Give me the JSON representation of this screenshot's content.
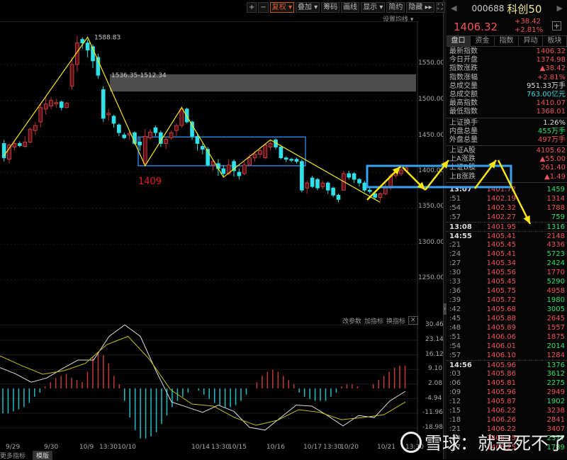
{
  "toolbar": {
    "zoom_in": "+",
    "zoom_out": "−",
    "items": [
      "复权 ▾",
      "叠加 ▾",
      "筹码",
      "画线",
      "显示 ▾",
      "简约",
      "隐藏 ▸▸"
    ],
    "fullscreen": "⛶"
  },
  "ma_setting": "设置均线 ▾",
  "price_axis": [
    "1550.00",
    "1500.00",
    "1450.00",
    "1400.00",
    "1350.00",
    "1300.00",
    "1250.00"
  ],
  "annotations": {
    "high": "1588.83",
    "range": "1536.35-1512.34",
    "low_label": "1409"
  },
  "macd_axis": [
    "30.46",
    "23.14",
    "16.12",
    "9.10",
    "2.08",
    "-4.94",
    "-11.96",
    "-18.98"
  ],
  "indicator_buttons": [
    "改参数",
    "加指标",
    "换指标",
    "✕"
  ],
  "x_labels": [
    "9/29",
    "9/30",
    "10/9",
    "13:30",
    "10/10",
    "10/14",
    "13:30",
    "10/15",
    "10/16",
    "10/17",
    "13:30",
    "10/20",
    "10/21",
    "13:30"
  ],
  "bottom_tabs": [
    "更多指标",
    "模版"
  ],
  "watermark": "雪球：就是死不了",
  "colors": {
    "up": "#e0474c",
    "down": "#2fe0e8",
    "zigzag": "#f5e614",
    "box": "#2a7fd4",
    "box2": "#3aa0f0"
  },
  "quote": {
    "code": "000688",
    "name": "科创50",
    "price": "1406.32",
    "change": "+38.42",
    "change_pct": "+2.81%",
    "plus": "+"
  },
  "tabs": [
    "盘口",
    "资金",
    "指数",
    "异动",
    "板块"
  ],
  "stats": [
    [
      [
        "最新指数",
        "1406.32",
        "r"
      ],
      [
        "今日开盘",
        "1374.98",
        "r"
      ],
      [
        "指数涨跌",
        "▲38.42",
        "r"
      ],
      [
        "指数涨幅",
        "+2.81%",
        "r"
      ],
      [
        "总成交量",
        "951.33万手",
        "w"
      ],
      [
        "总成交额",
        "763.00亿元",
        "c"
      ],
      [
        "最高指数",
        "1410.07",
        "r"
      ],
      [
        "最低指数",
        "1368.01",
        "r"
      ]
    ],
    [
      [
        "上证换手",
        "1.26%",
        "w"
      ],
      [
        "内盘总量",
        "455万手",
        "g"
      ],
      [
        "外盘总量",
        "497万手",
        "r"
      ]
    ],
    [
      [
        "上证A股",
        "4105.62",
        "r"
      ],
      [
        "上A涨跌",
        "▲55.00",
        "r"
      ],
      [
        "上证B股",
        "261.40",
        "r"
      ],
      [
        "上B涨跌",
        "▲1.49",
        "r"
      ]
    ]
  ],
  "ticks": [
    [
      "13:07",
      "1401.72",
      "1459",
      "g",
      1,
      0
    ],
    [
      ":51",
      "1402.19",
      "1314",
      "r",
      0,
      0
    ],
    [
      ":54",
      "1402.32",
      "1788",
      "r",
      0,
      0
    ],
    [
      ":57",
      "1402.27",
      "759",
      "g",
      0,
      0
    ],
    [
      "13:08",
      "1401.95",
      "1316",
      "g",
      1,
      1
    ],
    [
      "14:55",
      "1405.41",
      "2148",
      "r",
      1,
      1
    ],
    [
      ":21",
      "1405.45",
      "4336",
      "r",
      0,
      0
    ],
    [
      ":24",
      "1405.41",
      "5723",
      "g",
      0,
      0
    ],
    [
      ":27",
      "1405.34",
      "2424",
      "g",
      0,
      0
    ],
    [
      ":30",
      "1405.56",
      "1770",
      "r",
      0,
      0
    ],
    [
      ":33",
      "1405.45",
      "5290",
      "g",
      0,
      0
    ],
    [
      ":36",
      "1405.75",
      "4958",
      "r",
      0,
      0
    ],
    [
      ":39",
      "1405.72",
      "1980",
      "g",
      0,
      0
    ],
    [
      ":42",
      "1405.68",
      "3005",
      "g",
      0,
      0
    ],
    [
      ":45",
      "1405.88",
      "2645",
      "r",
      0,
      0
    ],
    [
      ":48",
      "1405.89",
      "1557",
      "r",
      0,
      0
    ],
    [
      ":51",
      "1406.06",
      "1875",
      "r",
      0,
      0
    ],
    [
      ":54",
      "1406.01",
      "2014",
      "g",
      0,
      0
    ],
    [
      ":57",
      "1406.10",
      "1284",
      "r",
      0,
      0
    ],
    [
      "14:56",
      "1405.96",
      "1376",
      "g",
      1,
      1
    ],
    [
      ":03",
      "1405.86",
      "3612",
      "g",
      0,
      0
    ],
    [
      ":06",
      "1405.81",
      "2275",
      "g",
      0,
      0
    ],
    [
      ":09",
      "1405.96",
      "2949",
      "r",
      0,
      0
    ],
    [
      ":12",
      "1405.87",
      "1902",
      "g",
      0,
      0
    ],
    [
      ":15",
      "1406.22",
      "3238",
      "r",
      0,
      0
    ],
    [
      ":18",
      "1406.26",
      "2841",
      "r",
      0,
      0
    ],
    [
      ":21",
      "1406.22",
      "3407",
      "r",
      0,
      0
    ],
    [
      ":24",
      "1406.25",
      "2377",
      "g",
      0,
      0
    ],
    [
      ":27",
      "1406.25",
      "1789",
      "g",
      0,
      0
    ]
  ],
  "chart_data": {
    "type": "candlestick",
    "candles_ochl": [
      [
        1440,
        1420,
        1445,
        1415
      ],
      [
        1418,
        1438,
        1440,
        1412
      ],
      [
        1435,
        1440,
        1445,
        1430
      ],
      [
        1440,
        1437,
        1443,
        1435
      ],
      [
        1436,
        1442,
        1450,
        1434
      ],
      [
        1442,
        1460,
        1462,
        1440
      ],
      [
        1458,
        1465,
        1470,
        1452
      ],
      [
        1470,
        1490,
        1495,
        1462
      ],
      [
        1488,
        1495,
        1505,
        1480
      ],
      [
        1492,
        1500,
        1505,
        1488
      ],
      [
        1495,
        1497,
        1502,
        1490
      ],
      [
        1498,
        1490,
        1500,
        1486
      ],
      [
        1490,
        1496,
        1498,
        1489
      ],
      [
        1520,
        1550,
        1560,
        1515
      ],
      [
        1550,
        1580,
        1590,
        1540
      ],
      [
        1585,
        1580,
        1588,
        1572
      ],
      [
        1580,
        1570,
        1585,
        1560
      ],
      [
        1575,
        1555,
        1578,
        1545
      ],
      [
        1560,
        1535,
        1565,
        1530
      ],
      [
        1515,
        1475,
        1520,
        1470
      ],
      [
        1480,
        1482,
        1488,
        1472
      ],
      [
        1478,
        1468,
        1480,
        1462
      ],
      [
        1466,
        1455,
        1468,
        1450
      ],
      [
        1452,
        1448,
        1455,
        1446
      ],
      [
        1452,
        1454,
        1456,
        1445
      ],
      [
        1455,
        1440,
        1457,
        1438
      ],
      [
        1442,
        1438,
        1448,
        1430
      ],
      [
        1412,
        1450,
        1460,
        1409
      ],
      [
        1448,
        1456,
        1460,
        1445
      ],
      [
        1462,
        1455,
        1465,
        1450
      ],
      [
        1455,
        1440,
        1458,
        1435
      ],
      [
        1440,
        1446,
        1450,
        1432
      ],
      [
        1448,
        1455,
        1458,
        1445
      ],
      [
        1458,
        1465,
        1468,
        1450
      ],
      [
        1465,
        1488,
        1492,
        1462
      ],
      [
        1488,
        1470,
        1490,
        1468
      ],
      [
        1470,
        1450,
        1472,
        1445
      ],
      [
        1450,
        1440,
        1455,
        1430
      ],
      [
        1436,
        1432,
        1440,
        1425
      ],
      [
        1432,
        1410,
        1435,
        1408
      ],
      [
        1410,
        1415,
        1418,
        1402
      ],
      [
        1412,
        1405,
        1418,
        1395
      ],
      [
        1405,
        1398,
        1410,
        1393
      ],
      [
        1398,
        1410,
        1418,
        1396
      ],
      [
        1415,
        1402,
        1418,
        1394
      ],
      [
        1400,
        1395,
        1405,
        1390
      ],
      [
        1398,
        1410,
        1415,
        1396
      ],
      [
        1410,
        1420,
        1425,
        1408
      ],
      [
        1420,
        1425,
        1430,
        1415
      ],
      [
        1425,
        1430,
        1435,
        1420
      ],
      [
        1420,
        1438,
        1440,
        1418
      ],
      [
        1435,
        1440,
        1445,
        1430
      ],
      [
        1445,
        1435,
        1447,
        1432
      ],
      [
        1435,
        1420,
        1438,
        1418
      ],
      [
        1420,
        1418,
        1422,
        1414
      ],
      [
        1418,
        1417,
        1420,
        1414
      ],
      [
        1418,
        1415,
        1420,
        1412
      ],
      [
        1415,
        1375,
        1418,
        1372
      ],
      [
        1378,
        1385,
        1388,
        1370
      ],
      [
        1392,
        1380,
        1395,
        1378
      ],
      [
        1390,
        1378,
        1392,
        1375
      ],
      [
        1380,
        1385,
        1388,
        1376
      ],
      [
        1385,
        1375,
        1387,
        1370
      ],
      [
        1378,
        1368,
        1380,
        1365
      ],
      [
        1368,
        1362,
        1370,
        1358
      ],
      [
        1375,
        1398,
        1402,
        1375
      ],
      [
        1398,
        1393,
        1402,
        1390
      ],
      [
        1398,
        1390,
        1400,
        1385
      ],
      [
        1390,
        1385,
        1392,
        1380
      ],
      [
        1385,
        1375,
        1388,
        1372
      ],
      [
        1375,
        1373,
        1378,
        1370
      ],
      [
        1370,
        1365,
        1372,
        1362
      ],
      [
        1365,
        1370,
        1372,
        1360
      ],
      [
        1370,
        1378,
        1385,
        1368
      ],
      [
        1378,
        1395,
        1398,
        1375
      ],
      [
        1395,
        1400,
        1405,
        1392
      ],
      [
        1398,
        1403,
        1408,
        1395
      ],
      [
        1402,
        1406,
        1410,
        1400
      ]
    ],
    "zigzag": [
      [
        0,
        1423
      ],
      [
        16,
        1588
      ],
      [
        27,
        1409
      ],
      [
        34,
        1490
      ],
      [
        42,
        1393
      ],
      [
        51,
        1445
      ],
      [
        72,
        1358
      ]
    ],
    "gap_zone": [
      1512.34,
      1536.35
    ],
    "box1": [
      1409,
      1449
    ],
    "box2": [
      1378,
      1406
    ],
    "price_range": [
      1225,
      1620
    ],
    "macd_range": [
      -22,
      36
    ],
    "dif": [
      10,
      7,
      3,
      5,
      9.5,
      13.6,
      13.6,
      25,
      30.5,
      25,
      8.5,
      -6.5,
      -9,
      -11.5,
      -8,
      -11,
      -18.7,
      -20,
      -14,
      -8,
      -8.5,
      -13,
      -18,
      -13,
      -14,
      -6,
      -1.4
    ],
    "dea": [
      15.6,
      11,
      6.8,
      8.5,
      12,
      21,
      25,
      14,
      -0.7,
      -7.5,
      -8.5,
      -14,
      -17.7,
      -15.3,
      -10.2,
      -11.5,
      -15,
      -14,
      -12.6,
      -6.5
    ],
    "hist": [
      -12,
      -12,
      -11,
      -10,
      -9,
      -7,
      -4,
      -2,
      1,
      3,
      5,
      6,
      7,
      5,
      4,
      3,
      8,
      15,
      17,
      16,
      12,
      6,
      2,
      -6,
      -14,
      -20,
      -24,
      -24,
      -23,
      -21,
      -17,
      -13,
      -9,
      -6,
      -4,
      -2,
      0,
      -1,
      -3,
      -5,
      -7,
      -8,
      -9,
      -9,
      -8,
      -6,
      -3,
      0,
      3,
      6,
      8,
      9,
      8,
      6,
      4,
      2,
      -2,
      -4,
      -5,
      -6,
      -6,
      -6,
      -4,
      -2,
      1,
      2,
      2,
      1,
      0,
      0,
      2,
      4,
      6,
      8,
      10,
      11,
      11
    ]
  }
}
